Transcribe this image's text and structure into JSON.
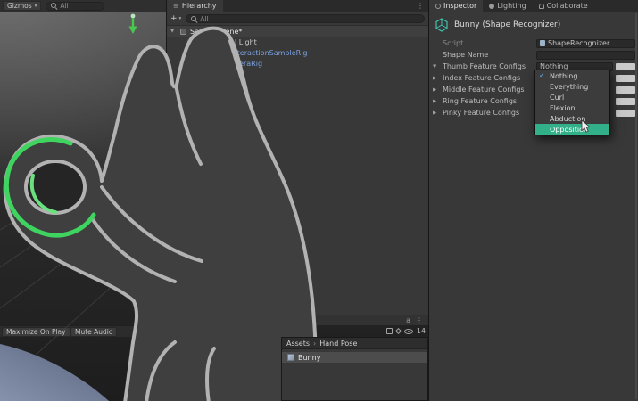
{
  "scene": {
    "gizmos_label": "Gizmos",
    "search_placeholder": "All",
    "maximize_on_play": "Maximize On Play",
    "mute_audio": "Mute Audio",
    "overlay_count": "14"
  },
  "hierarchy": {
    "title": "Hierarchy",
    "create_button": "+",
    "search_placeholder": "All",
    "bottom_label": "a",
    "items": [
      {
        "label": "SampleScene*"
      },
      {
        "label": "Directional Light"
      },
      {
        "label": "HandsInteractionSampleRig"
      },
      {
        "label": "OVRCameraRig"
      }
    ]
  },
  "project": {
    "breadcrumb_root": "Assets",
    "breadcrumb_current": "Hand Pose",
    "item_label": "Bunny"
  },
  "inspector": {
    "tabs": [
      {
        "label": "Inspector"
      },
      {
        "label": "Lighting"
      },
      {
        "label": "Collaborate"
      }
    ],
    "header_title": "Bunny (Shape Recognizer)",
    "script_label": "Script",
    "script_value": "ShapeRecognizer",
    "shape_name_label": "Shape Name",
    "config_rows": [
      {
        "label": "Thumb Feature Configs",
        "value": "Nothing"
      },
      {
        "label": "Index Feature Configs"
      },
      {
        "label": "Middle Feature Configs"
      },
      {
        "label": "Ring Feature Configs"
      },
      {
        "label": "Pinky Feature Configs"
      }
    ],
    "dropdown_options": [
      {
        "label": "Nothing"
      },
      {
        "label": "Everything"
      },
      {
        "label": "Curl"
      },
      {
        "label": "Flexion"
      },
      {
        "label": "Abduction"
      },
      {
        "label": "Opposition"
      }
    ]
  },
  "colors": {
    "hand_highlight_green": "#3fd45f",
    "dropdown_highlight_teal": "#32b089",
    "prefab_text_blue": "#7aa1e0",
    "checkmark_blue": "#6ab0f3"
  }
}
